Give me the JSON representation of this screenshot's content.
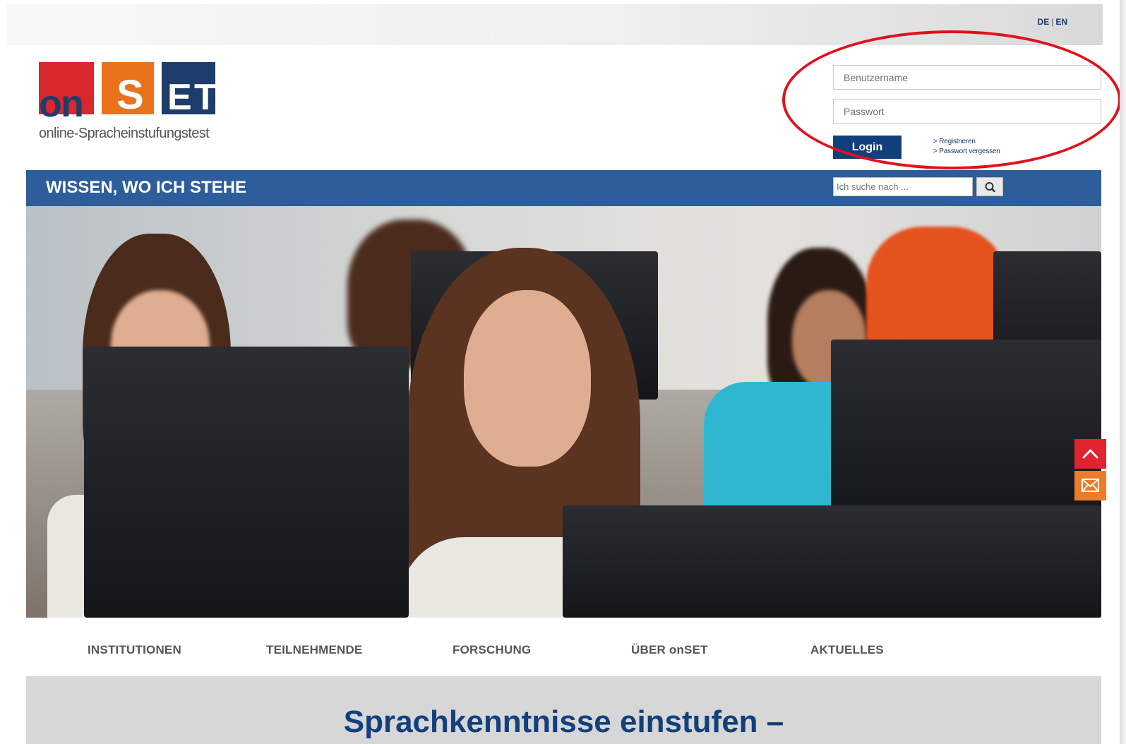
{
  "topbar": {
    "lang_de": "DE",
    "lang_sep": "|",
    "lang_en": "EN"
  },
  "logo": {
    "on": "on",
    "s": "S",
    "e": "E",
    "t": "T",
    "subtitle": "online-Spracheinstufungstest"
  },
  "login": {
    "username_placeholder": "Benutzername",
    "password_placeholder": "Passwort",
    "button": "Login",
    "register": "> Registrieren",
    "forgot": "> Passwort vergessen"
  },
  "hero": {
    "slogan": "WISSEN, WO ICH STEHE",
    "search_placeholder": "Ich suche nach ..."
  },
  "nav": [
    "INSTITUTIONEN",
    "TEILNEHMENDE",
    "FORSCHUNG",
    "ÜBER onSET",
    "AKTUELLES"
  ],
  "intro": {
    "headline": "Sprachkenntnisse einstufen –"
  },
  "colors": {
    "brand_blue": "#12407c",
    "bar_blue": "#2d5d9a",
    "red": "#d9272e",
    "orange": "#e8731c",
    "highlight": "#e0121b"
  },
  "icons": {
    "search": "search-icon",
    "up": "arrow-up-icon",
    "mail": "mail-icon"
  }
}
